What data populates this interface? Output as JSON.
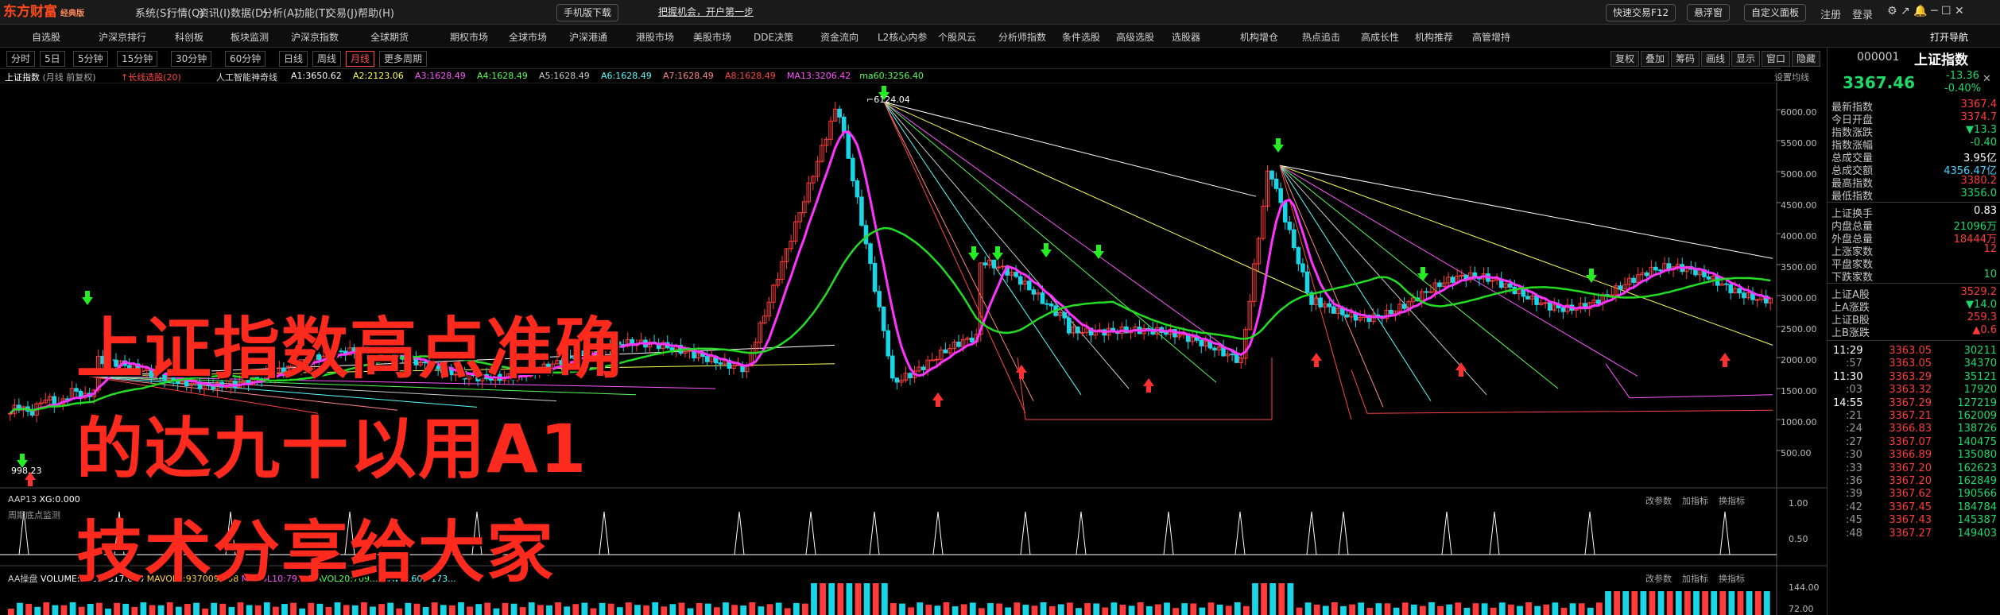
{
  "app": {
    "logo": "东方财富",
    "edition": "经典版"
  },
  "menu": [
    "系统(S)",
    "行情(Q)",
    "资讯(I)",
    "数据(D)",
    "分析(A)",
    "功能(T)",
    "交易(J)",
    "帮助(H)"
  ],
  "top_buttons": {
    "mobile": "手机版下载",
    "promo": "把握机会，开户第一步",
    "quick_trade": "快速交易F12",
    "float": "悬浮窗",
    "custom": "自定义面板",
    "login": "注册",
    "logout": "登录"
  },
  "nav": [
    "自选股",
    "沪深京排行",
    "科创板",
    "板块监测",
    "沪深京指数",
    "全球期货",
    "期权市场",
    "全球市场",
    "沪深港通",
    "港股市场",
    "美股市场",
    "DDE决策",
    "资金流向",
    "L2核心内参",
    "个股风云",
    "分析师指数",
    "条件选股",
    "高级选股",
    "选股器",
    "机构增仓",
    "热点追击",
    "高成长性",
    "机构推荐",
    "高管增持"
  ],
  "nav_right": "打开导航",
  "periods": [
    "分时",
    "5日",
    "5分钟",
    "15分钟",
    "30分钟",
    "60分钟",
    "日线",
    "周线",
    "月线",
    "更多周期"
  ],
  "active_period": "月线",
  "toolbar": [
    "复权",
    "叠加",
    "筹码",
    "画线",
    "显示",
    "窗口",
    "隐藏"
  ],
  "chart_header": {
    "name": "上证指数",
    "sub": "(月线 前复权)",
    "ind1": "长线选股(20)",
    "ind2": "人工智能神奇线",
    "settings": "设置均线"
  },
  "indicators": [
    {
      "t": "A1:3650.62",
      "c": "#ffffff"
    },
    {
      "t": "A2:2123.06",
      "c": "#ffff55"
    },
    {
      "t": "A3:1628.49",
      "c": "#ff55ff"
    },
    {
      "t": "A4:1628.49",
      "c": "#55ff55"
    },
    {
      "t": "A5:1628.49",
      "c": "#cccccc"
    },
    {
      "t": "A6:1628.49",
      "c": "#55ffff"
    },
    {
      "t": "A7:1628.49",
      "c": "#ff8888"
    },
    {
      "t": "A8:1628.49",
      "c": "#ff4444"
    },
    {
      "t": "MA13:3206.42",
      "c": "#ff55ff"
    },
    {
      "t": "ma60:3256.40",
      "c": "#55ff55"
    }
  ],
  "price_axis": [
    "6000.00",
    "5500.00",
    "5000.00",
    "4500.00",
    "4000.00",
    "3500.00",
    "3000.00",
    "2500.00",
    "2000.00",
    "1500.00",
    "1000.00",
    "500.00"
  ],
  "peak_label": "6124.04",
  "low_label": "998.23",
  "sub1": {
    "label": "AAP13",
    "value": "XG:0.000",
    "caption": "周期底点监测",
    "btns": [
      "改参数",
      "加指标",
      "换指标"
    ],
    "axis": [
      "1.00",
      "0.50"
    ]
  },
  "sub2": {
    "label": "AA操盘",
    "vol": "VOLUME:39173317.000",
    "ma5": "MAVOL5:937009.608",
    "ma10": "MAVOL10:79...",
    "ma20": "MAVOL20:709...",
    "ma60": "MAVOL60:1173...",
    "btns": [
      "改参数",
      "加指标",
      "换指标"
    ],
    "axis": [
      "144.00",
      "72.00"
    ]
  },
  "headline": [
    "上证指数高点准确",
    "的达九十以用A1",
    "技术分享给大家"
  ],
  "quote": {
    "code": "000001",
    "name": "上证指数",
    "price": "3367.46",
    "change": "-13.36",
    "pct": "-0.40%"
  },
  "stats": [
    {
      "k": "最新指数",
      "v": "3367.4",
      "c": "red"
    },
    {
      "k": "今日开盘",
      "v": "3374.7",
      "c": "red"
    },
    {
      "k": "指数涨跌",
      "v": "▼13.3",
      "c": "green"
    },
    {
      "k": "指数涨幅",
      "v": "-0.40",
      "c": "green"
    },
    {
      "k": "总成交量",
      "v": "3.95亿",
      "c": "white"
    },
    {
      "k": "总成交额",
      "v": "4356.47亿",
      "c": "cyan"
    },
    {
      "k": "最高指数",
      "v": "3380.2",
      "c": "red"
    },
    {
      "k": "最低指数",
      "v": "3356.0",
      "c": "green"
    }
  ],
  "stats2": [
    {
      "k": "上证换手",
      "v": "0.83",
      "c": "white"
    },
    {
      "k": "内盘总量",
      "v": "21096万",
      "c": "green"
    },
    {
      "k": "外盘总量",
      "v": "18444万",
      "c": "red"
    },
    {
      "k": "上涨家数",
      "v": "12",
      "c": "red"
    },
    {
      "k": "平盘家数",
      "v": "",
      "c": "white"
    },
    {
      "k": "下跌家数",
      "v": "10",
      "c": "green"
    }
  ],
  "stats3": [
    {
      "k": "上证A股",
      "v": "3529.2",
      "c": "red"
    },
    {
      "k": "上A涨跌",
      "v": "▼14.0",
      "c": "green"
    },
    {
      "k": "上证B股",
      "v": "259.3",
      "c": "red"
    },
    {
      "k": "上B涨跌",
      "v": "▲0.6",
      "c": "red"
    }
  ],
  "ticks": [
    {
      "t": "11:29",
      "p": "3363.05",
      "v": "30211",
      "c": "green"
    },
    {
      "t": ":57",
      "p": "3363.05",
      "v": "34370",
      "c": "green"
    },
    {
      "t": "11:30",
      "p": "3363.29",
      "v": "35121",
      "c": "green"
    },
    {
      "t": ":03",
      "p": "3363.32",
      "v": "17920",
      "c": "green"
    },
    {
      "t": "14:55",
      "p": "3367.29",
      "v": "127219",
      "c": "green"
    },
    {
      "t": ":21",
      "p": "3367.21",
      "v": "162009",
      "c": "green"
    },
    {
      "t": ":24",
      "p": "3366.83",
      "v": "138726",
      "c": "green"
    },
    {
      "t": ":27",
      "p": "3367.07",
      "v": "140475",
      "c": "green"
    },
    {
      "t": ":30",
      "p": "3366.89",
      "v": "135080",
      "c": "green"
    },
    {
      "t": ":33",
      "p": "3367.20",
      "v": "162623",
      "c": "green"
    },
    {
      "t": ":36",
      "p": "3367.20",
      "v": "162849",
      "c": "green"
    },
    {
      "t": ":39",
      "p": "3367.62",
      "v": "190566",
      "c": "green"
    },
    {
      "t": ":42",
      "p": "3367.45",
      "v": "184784",
      "c": "green"
    },
    {
      "t": ":45",
      "p": "3367.43",
      "v": "145387",
      "c": "green"
    },
    {
      "t": ":48",
      "p": "3367.27",
      "v": "149403",
      "c": "green"
    }
  ]
}
